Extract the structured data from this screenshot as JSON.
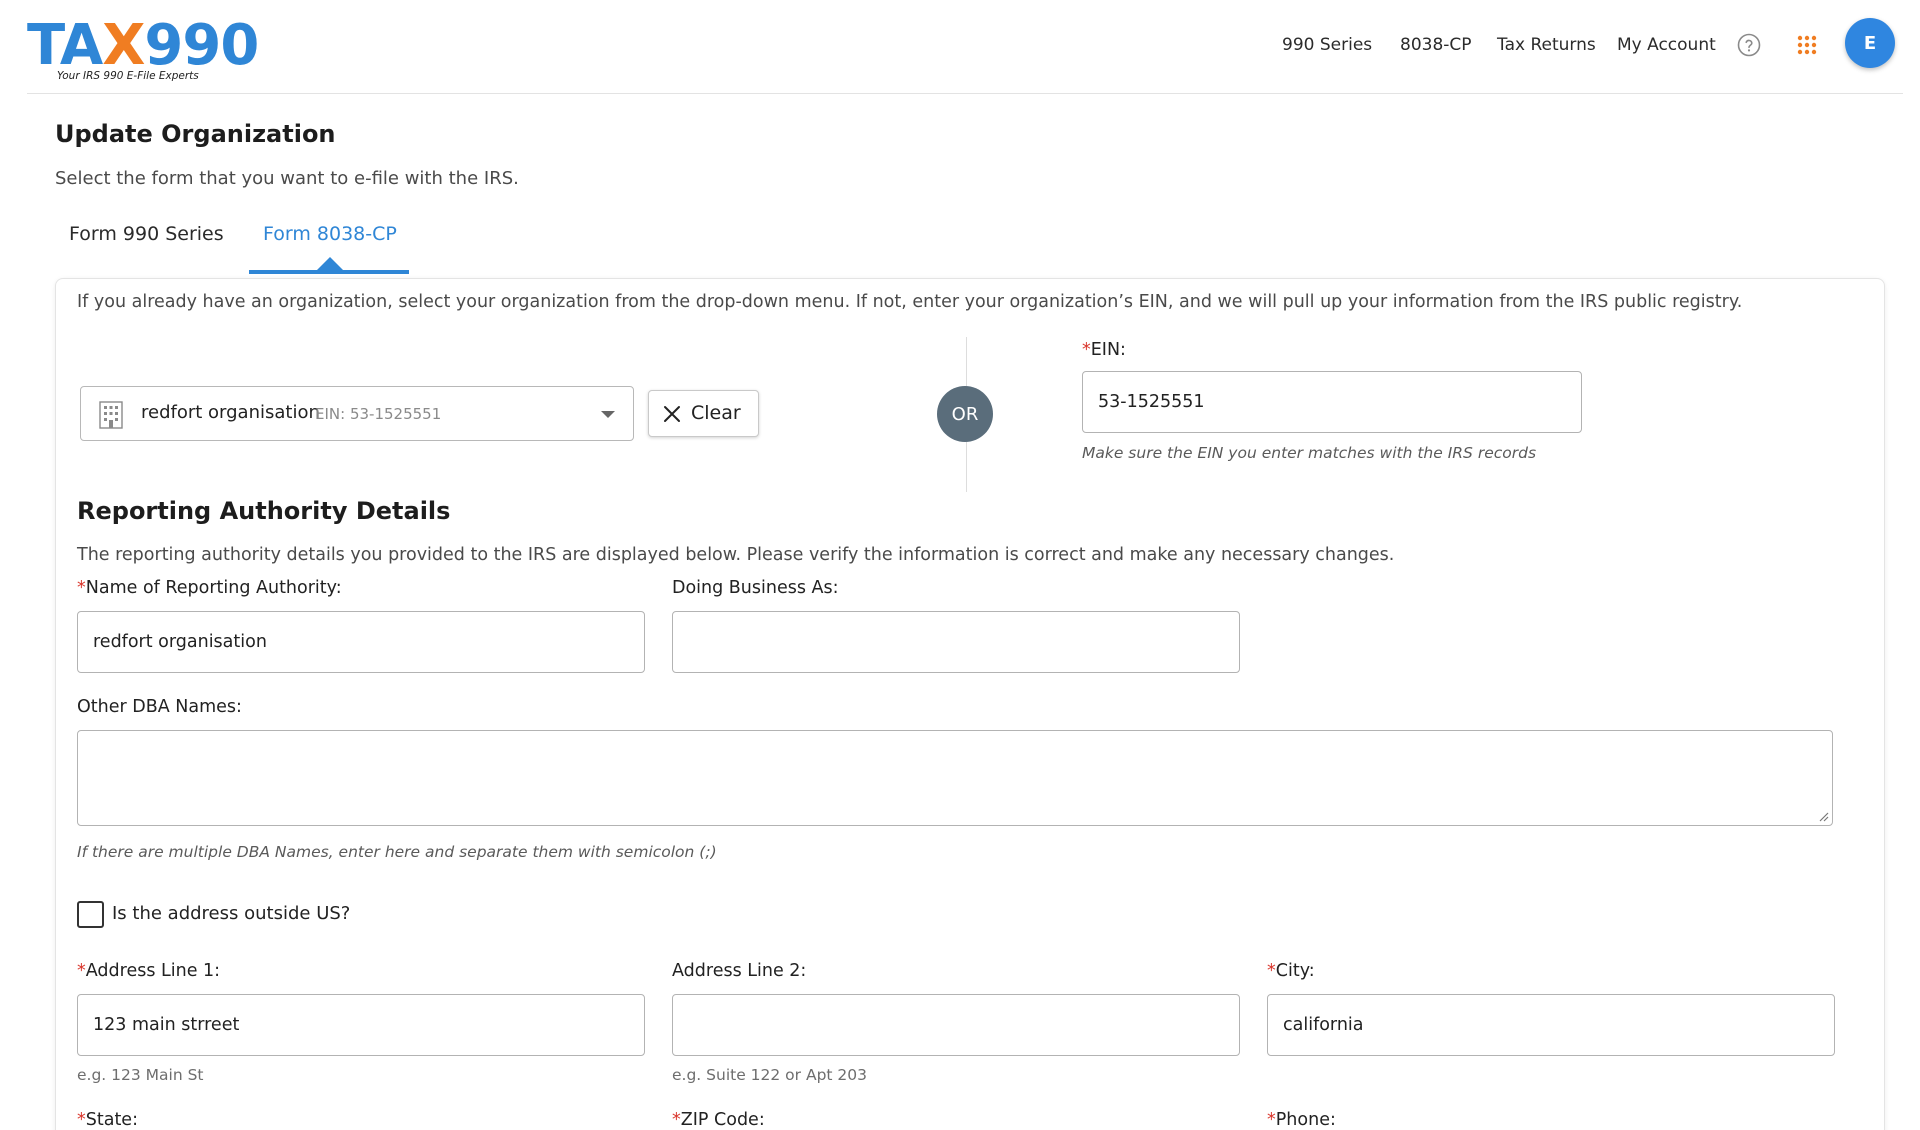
{
  "header": {
    "logo": {
      "ta": "TA",
      "x": "X",
      "num": "990",
      "tagline": "Your IRS 990 E-File Experts"
    },
    "nav": [
      "990 Series",
      "8038-CP",
      "Tax Returns",
      "My Account"
    ],
    "avatar_letter": "E",
    "icons": {
      "help": "help-circle-icon",
      "apps": "apps-grid-icon"
    }
  },
  "page": {
    "title": "Update Organization",
    "subtitle": "Select the form that you want to e-file with the IRS."
  },
  "tabs": [
    {
      "label": "Form 990 Series",
      "active": false
    },
    {
      "label": "Form 8038-CP",
      "active": true
    }
  ],
  "org_lookup": {
    "intro": "If you already have an organization, select your organization from the drop-down menu. If not, enter your organization’s EIN, and we will pull up your information from the IRS public registry.",
    "selected_name": "redfort organisation",
    "selected_ein": "EIN: 53-1525551",
    "clear_label": "Clear",
    "or_label": "OR",
    "ein_label": "EIN:",
    "ein_value": "53-1525551",
    "ein_hint": "Make sure the EIN you enter matches with the IRS records"
  },
  "reporting": {
    "title": "Reporting Authority Details",
    "description": "The reporting authority details you provided to the IRS are displayed below. Please verify the information is correct and make any necessary changes.",
    "name_label": "Name of Reporting Authority:",
    "name_value": "redfort organisation",
    "dba_label": "Doing Business As:",
    "dba_value": "",
    "other_dba_label": "Other DBA Names:",
    "other_dba_value": "",
    "other_dba_hint": "If there are multiple DBA Names, enter here and separate them with semicolon (;)",
    "outside_us_label": "Is the address outside US?",
    "outside_us_checked": false,
    "address1_label": "Address Line 1:",
    "address1_value": "123 main strreet",
    "address1_hint": "e.g. 123 Main St",
    "address2_label": "Address Line 2:",
    "address2_value": "",
    "address2_hint": "e.g. Suite 122 or Apt 203",
    "city_label": "City:",
    "city_value": "california",
    "state_label": "State:",
    "zip_label": "ZIP Code:",
    "phone_label": "Phone:"
  },
  "colors": {
    "brand_blue": "#2f86d6",
    "brand_orange": "#f07d22",
    "required": "#d9352b",
    "or_badge": "#5a6d7b"
  }
}
